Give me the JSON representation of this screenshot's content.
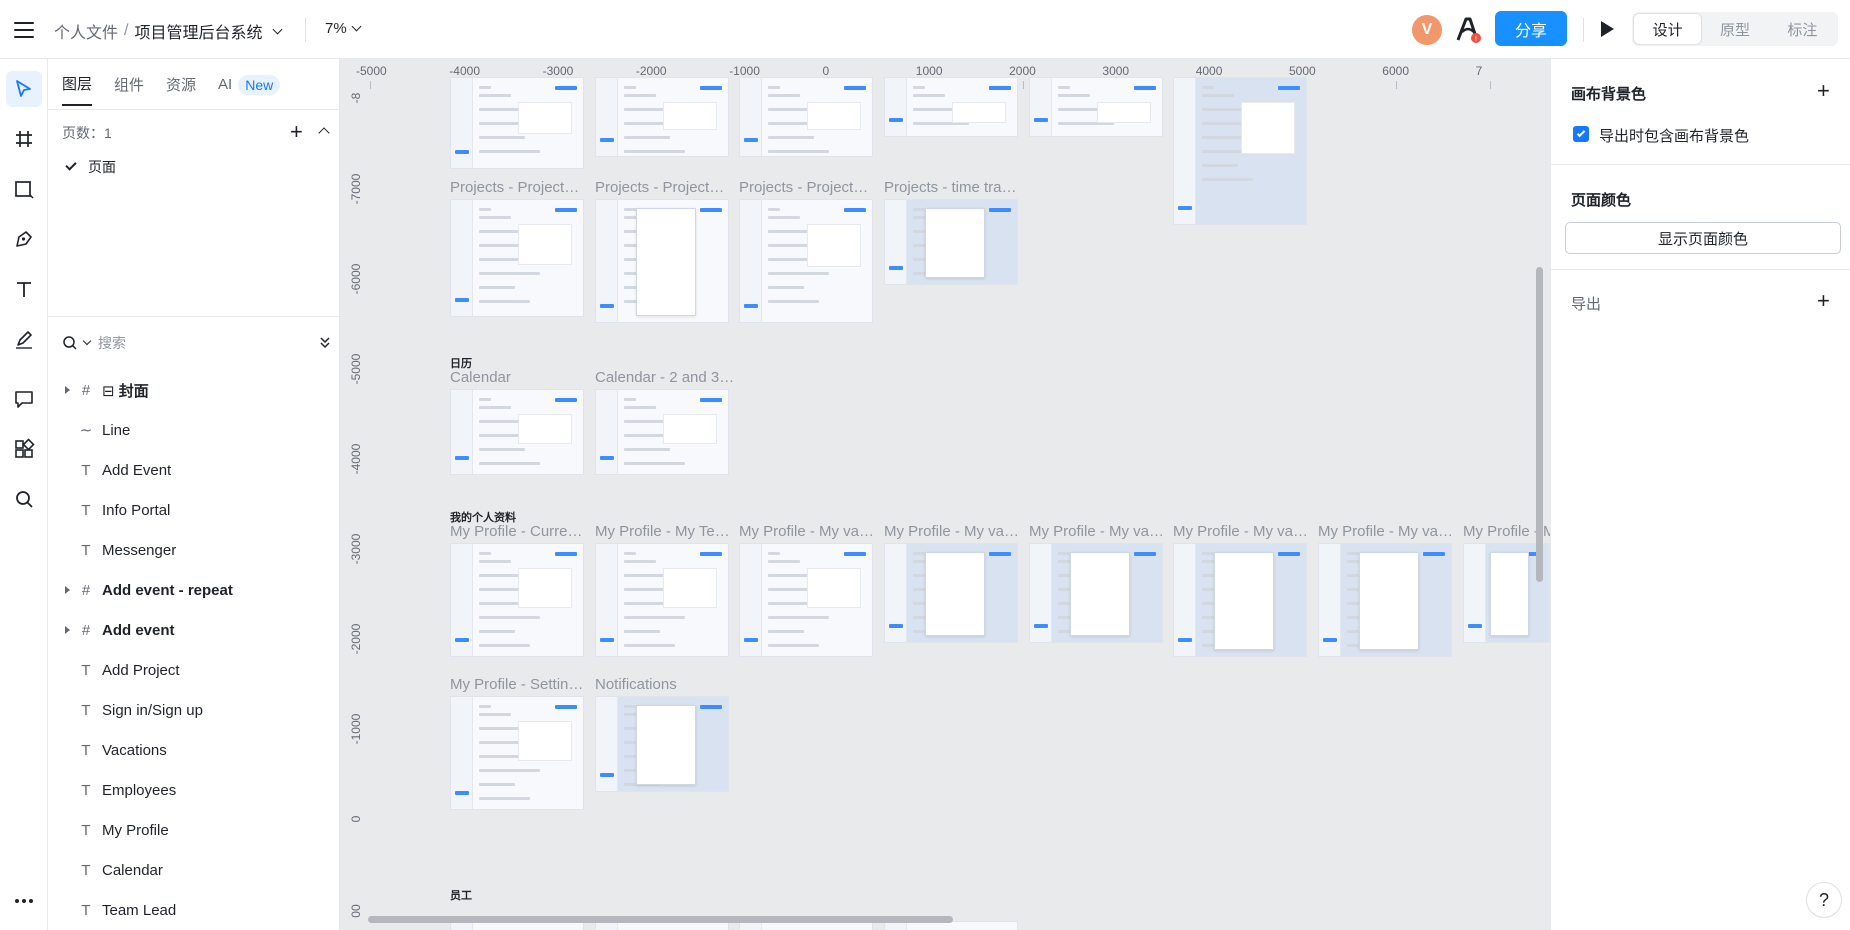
{
  "header": {
    "breadcrumb_parent": "个人文件",
    "breadcrumb_sep": "/",
    "file_name": "项目管理后台系统",
    "zoom": "7%",
    "avatar_initial": "V",
    "share_label": "分享",
    "mode_tabs": [
      "设计",
      "原型",
      "标注"
    ],
    "active_mode": "设计"
  },
  "tools": [
    "select-tool",
    "frame-tool",
    "shape-tool",
    "pen-tool",
    "text-tool",
    "pencil-tool",
    "comment-tool",
    "plugins-tool",
    "search-tool",
    "more-tool"
  ],
  "panel": {
    "tabs": [
      "图层",
      "组件",
      "资源",
      "AI"
    ],
    "new_badge": "New",
    "pages_label": "页数：1",
    "page_name": "页面",
    "search_placeholder": "搜索"
  },
  "layers": [
    {
      "name": "封面",
      "type": "frame-group",
      "bold": true,
      "expandable": true
    },
    {
      "name": "Line",
      "type": "line",
      "bold": false,
      "expandable": false
    },
    {
      "name": "Add Event",
      "type": "text",
      "bold": false,
      "expandable": false
    },
    {
      "name": "Info Portal",
      "type": "text",
      "bold": false,
      "expandable": false
    },
    {
      "name": "Messenger",
      "type": "text",
      "bold": false,
      "expandable": false
    },
    {
      "name": "Add event - repeat",
      "type": "frame",
      "bold": true,
      "expandable": true
    },
    {
      "name": "Add event",
      "type": "frame",
      "bold": true,
      "expandable": true
    },
    {
      "name": "Add Project",
      "type": "text",
      "bold": false,
      "expandable": false
    },
    {
      "name": "Sign in/Sign up",
      "type": "text",
      "bold": false,
      "expandable": false
    },
    {
      "name": "Vacations",
      "type": "text",
      "bold": false,
      "expandable": false
    },
    {
      "name": "Employees",
      "type": "text",
      "bold": false,
      "expandable": false
    },
    {
      "name": "My Profile",
      "type": "text",
      "bold": false,
      "expandable": false
    },
    {
      "name": "Calendar",
      "type": "text",
      "bold": false,
      "expandable": false
    },
    {
      "name": "Team Lead",
      "type": "text",
      "bold": false,
      "expandable": false
    }
  ],
  "canvas": {
    "ruler_x": [
      "-5000",
      "-4000",
      "-3000",
      "-2000",
      "-1000",
      "0",
      "1000",
      "2000",
      "3000",
      "4000",
      "5000",
      "6000",
      "7"
    ],
    "ruler_y": [
      "-8",
      "-7000",
      "-6000",
      "-5000",
      "-4000",
      "-3000",
      "-2000",
      "-1000",
      "0",
      "00"
    ],
    "sections": [
      "日历",
      "我的个人资料",
      "员工"
    ],
    "frame_titles_projects": [
      "Projects - Project…",
      "Projects - Project…",
      "Projects - Project…",
      "Projects - time tra…"
    ],
    "frame_titles_calendar": [
      "Calendar",
      "Calendar - 2 and 3…"
    ],
    "frame_titles_profile": [
      "My Profile - Curre…",
      "My Profile - My Te…",
      "My Profile - My va…",
      "My Profile - My va…",
      "My Profile - My va…",
      "My Profile - My va…",
      "My Profile - My va…",
      "My Profile - M"
    ],
    "frame_titles_settings": [
      "My Profile - Settin…",
      "Notifications"
    ]
  },
  "right_panel": {
    "canvas_bg_title": "画布背景色",
    "include_bg_label": "导出时包含画布背景色",
    "include_bg_checked": true,
    "page_color_title": "页面颜色",
    "show_page_color_btn": "显示页面颜色",
    "export_label": "导出",
    "help": "?"
  },
  "colors": {
    "accent": "#1890ff",
    "canvas_bg": "#e9eaec",
    "avatar": "#f2976b"
  }
}
